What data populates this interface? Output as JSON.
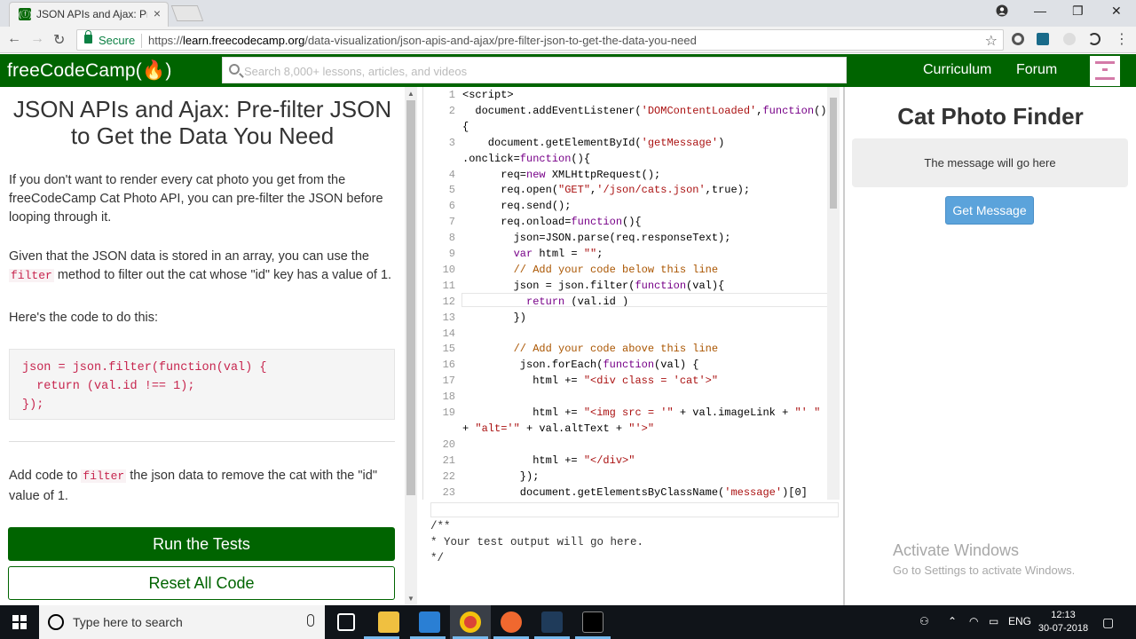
{
  "browser": {
    "tab_title": "JSON APIs and Ajax: Pre-",
    "tab_close": "×",
    "secure_label": "Secure",
    "url_scheme": "https://",
    "url_host": "learn.freecodecamp.org",
    "url_path": "/data-visualization/json-apis-and-ajax/pre-filter-json-to-get-the-data-you-need",
    "window_minimize": "—",
    "window_maximize": "❐",
    "window_close": "✕"
  },
  "fcc_nav": {
    "logo": "freeCodeCamp(🔥)",
    "search_placeholder": "Search 8,000+ lessons, articles, and videos",
    "links": [
      "Curriculum",
      "Forum"
    ]
  },
  "lesson": {
    "title": "JSON APIs and Ajax: Pre-filter JSON to Get the Data You Need",
    "para1": "If you don't want to render every cat photo you get from the freeCodeCamp Cat Photo API, you can pre-filter the JSON before looping through it.",
    "para2_a": "Given that the JSON data is stored in an array, you can use the ",
    "para2_code": "filter",
    "para2_b": " method to filter out the cat whose \"id\" key has a value of 1.",
    "para3": "Here's the code to do this:",
    "code_example": "json = json.filter(function(val) {\n  return (val.id !== 1);\n});",
    "para4_a": "Add code to ",
    "para4_code": "filter",
    "para4_b": " the json data to remove the cat with the \"id\" value of 1.",
    "run_button": "Run the Tests",
    "reset_button": "Reset All Code"
  },
  "editor": {
    "lines": [
      {
        "n": "1",
        "text": "<script>"
      },
      {
        "n": "2",
        "text": "  document.addEventListener('DOMContentLoaded',function()"
      },
      {
        "n": "",
        "text": "{"
      },
      {
        "n": "3",
        "text": "    document.getElementById('getMessage')"
      },
      {
        "n": "",
        "text": ".onclick=function(){"
      },
      {
        "n": "4",
        "text": "      req=new XMLHttpRequest();"
      },
      {
        "n": "5",
        "text": "      req.open(\"GET\",'/json/cats.json',true);"
      },
      {
        "n": "6",
        "text": "      req.send();"
      },
      {
        "n": "7",
        "text": "      req.onload=function(){"
      },
      {
        "n": "8",
        "text": "        json=JSON.parse(req.responseText);"
      },
      {
        "n": "9",
        "text": "        var html = \"\";"
      },
      {
        "n": "10",
        "text": "        // Add your code below this line"
      },
      {
        "n": "11",
        "text": "        json = json.filter(function(val){"
      },
      {
        "n": "12",
        "text": "          return (val.id )"
      },
      {
        "n": "13",
        "text": "        })"
      },
      {
        "n": "14",
        "text": ""
      },
      {
        "n": "15",
        "text": "        // Add your code above this line"
      },
      {
        "n": "16",
        "text": "         json.forEach(function(val) {"
      },
      {
        "n": "17",
        "text": "           html += \"<div class = 'cat'>\""
      },
      {
        "n": "18",
        "text": ""
      },
      {
        "n": "19",
        "text": "           html += \"<img src = '\" + val.imageLink + \"' \""
      },
      {
        "n": "",
        "text": "+ \"alt='\" + val.altText + \"'>\""
      },
      {
        "n": "20",
        "text": ""
      },
      {
        "n": "21",
        "text": "           html += \"</div>\""
      },
      {
        "n": "22",
        "text": "         });"
      },
      {
        "n": "23",
        "text": "         document.getElementsByClassName('message')[0]"
      }
    ],
    "test_output": "/**\n* Your test output will go here.\n*/"
  },
  "preview": {
    "title": "Cat Photo Finder",
    "message": "The message will go here",
    "button": "Get Message",
    "watermark_title": "Activate Windows",
    "watermark_sub": "Go to Settings to activate Windows."
  },
  "taskbar": {
    "search_label": "Type here to search",
    "language": "ENG",
    "time": "12:13",
    "date": "30-07-2018"
  },
  "colors": {
    "fcc_green": "#006400",
    "button_blue": "#5ba3db"
  }
}
